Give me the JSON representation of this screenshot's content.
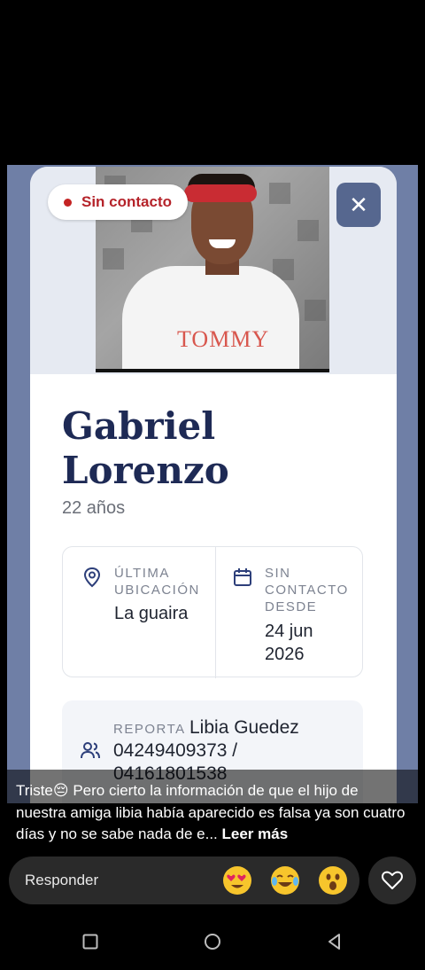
{
  "story": {
    "badge_text": "Sin contacto",
    "close_symbol": "✕",
    "photo_shirt_text": "TOMMY",
    "name_line1": "Gabriel",
    "name_line2": "Lorenzo",
    "age": "22 años",
    "last_location": {
      "label_line1": "ÚLTIMA",
      "label_line2": "UBICACIÓN",
      "value": "La guaira",
      "icon": "location-pin-icon"
    },
    "no_contact_since": {
      "label_line1": "SIN",
      "label_line2": "CONTACTO",
      "label_line3": "DESDE",
      "value_line1": "24 jun",
      "value_line2": "2026",
      "icon": "calendar-icon"
    },
    "report": {
      "label": "REPORTA",
      "value": "Libia Guedez 04249409373 / 04161801538",
      "icon": "users-icon"
    },
    "colors": {
      "badge_red": "#b5232a",
      "navy": "#1e2a55",
      "close_bg": "#56678f",
      "frame": "#6f7fa6"
    }
  },
  "caption": {
    "text": "Triste😔 Pero cierto la información de  que el hijo de nuestra amiga libia había aparecido es falsa ya son cuatro días y no se sabe nada de e...",
    "more_label": "Leer más"
  },
  "reply_bar": {
    "placeholder": "Responder",
    "reactions": [
      "heart-eyes-emoji",
      "tears-of-joy-emoji",
      "surprised-emoji"
    ],
    "like_icon": "heart-outline-icon"
  },
  "nav_bar": {
    "icons": [
      "recent-apps-icon",
      "home-icon",
      "back-icon"
    ]
  }
}
